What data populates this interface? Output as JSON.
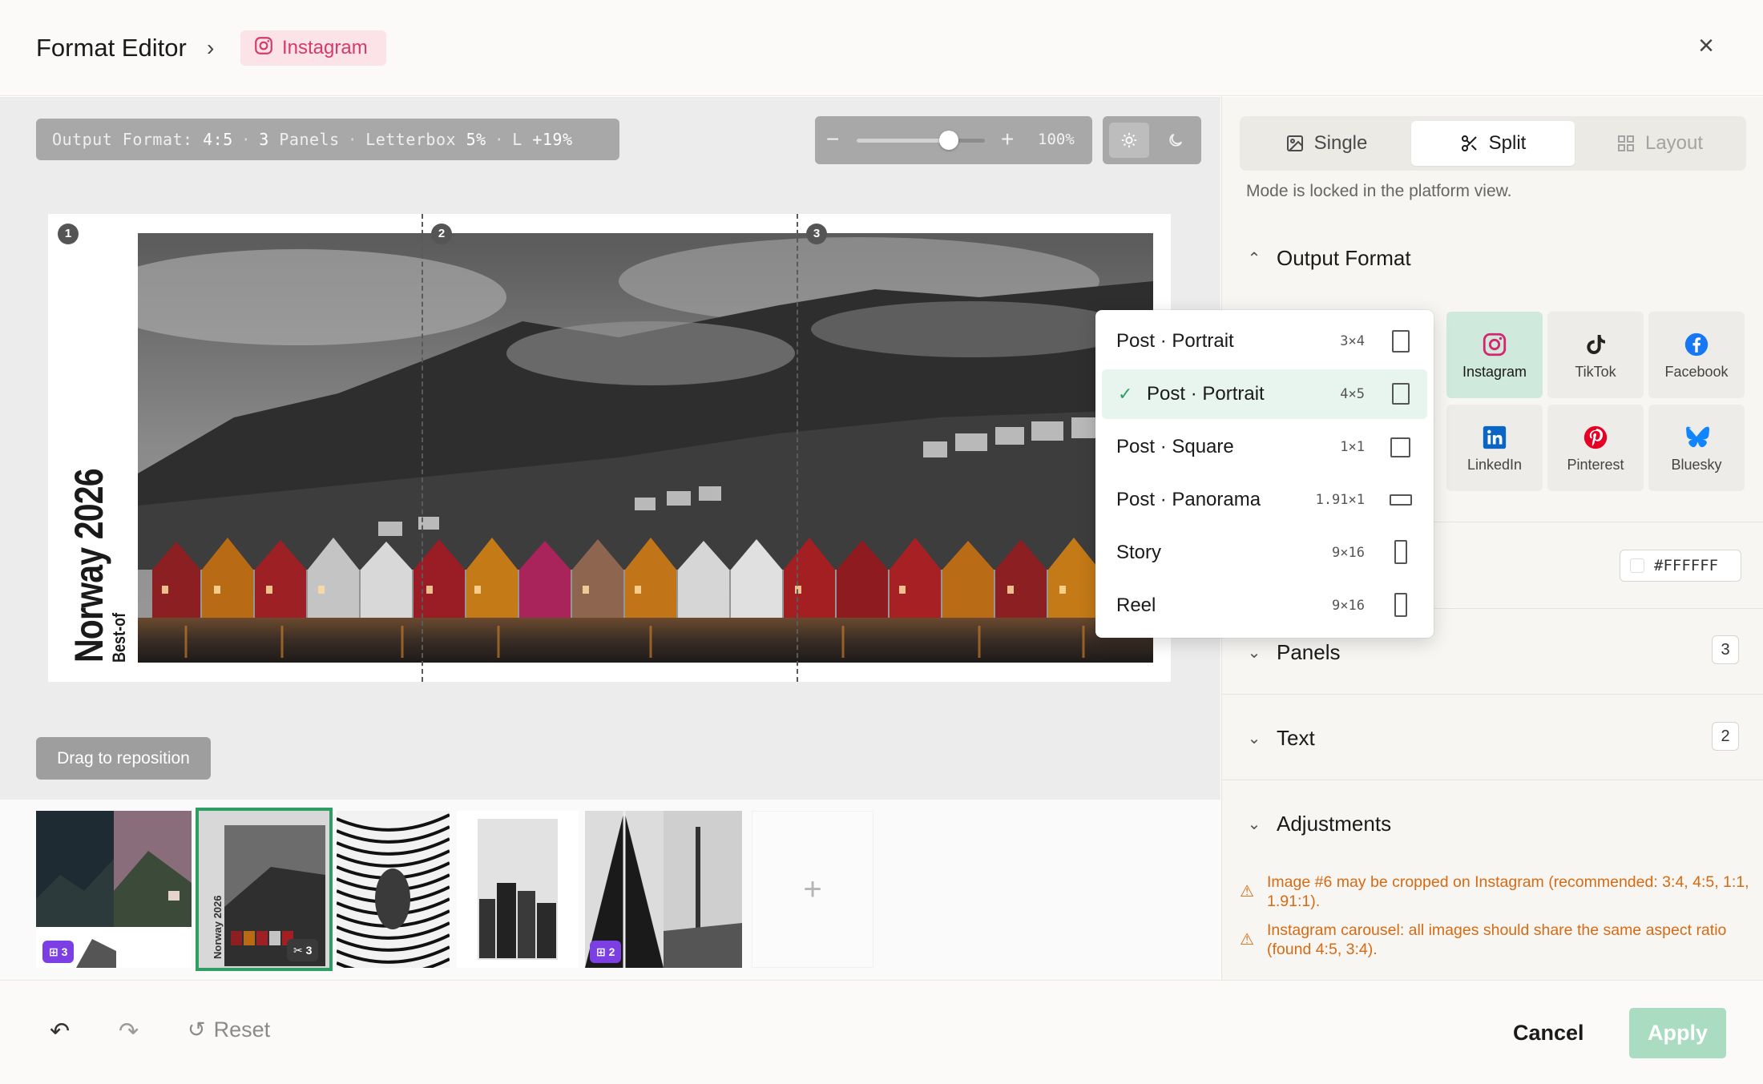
{
  "header": {
    "title": "Format Editor",
    "separator": "›",
    "platform": "Instagram",
    "close": "×"
  },
  "canvas": {
    "format_pill": {
      "label": "Output Format:",
      "ratio": "4:5",
      "panels_count": "3",
      "panels_label": "Panels",
      "letterbox_label": "Letterbox",
      "letterbox_value": "5%",
      "l_label": "L",
      "l_value": "+19%"
    },
    "zoom": {
      "minus": "−",
      "plus": "+",
      "value": "100%",
      "level": 0.72
    },
    "panels": [
      "1",
      "2",
      "3"
    ],
    "side_title": "Norway 2026",
    "side_subtitle": "Best-of",
    "drag_hint": "Drag to reposition"
  },
  "filmstrip": {
    "thumbs": [
      {
        "badge": "⊞ 3",
        "badge_style": "purple"
      },
      {
        "badge": "✂ 3",
        "badge_style": "dark",
        "selected": true
      },
      {
        "badge": ""
      },
      {
        "badge": ""
      },
      {
        "badge": "⊞ 2",
        "badge_style": "purple"
      }
    ],
    "add": "+"
  },
  "footer": {
    "undo": "↶",
    "redo": "↷",
    "reset": "Reset",
    "cancel": "Cancel",
    "apply": "Apply"
  },
  "panel": {
    "modes": [
      {
        "label": "Single",
        "state": "normal"
      },
      {
        "label": "Split",
        "state": "active"
      },
      {
        "label": "Layout",
        "state": "disabled"
      }
    ],
    "mode_note": "Mode is locked in the platform view.",
    "output_format": "Output Format",
    "platforms": [
      {
        "label": "Instagram",
        "active": true
      },
      {
        "label": "TikTok"
      },
      {
        "label": "Facebook"
      },
      {
        "label": "LinkedIn"
      },
      {
        "label": "Pinterest"
      },
      {
        "label": "Bluesky"
      }
    ],
    "background_color": "#FFFFFF",
    "panels_label": "Panels",
    "panels_count": "3",
    "text_label": "Text",
    "text_count": "2",
    "adjustments_label": "Adjustments",
    "warnings": [
      "Image #6 may be cropped on Instagram (recommended: 3:4, 4:5, 1:1, 1.91:1).",
      "Instagram carousel: all images should share the same aspect ratio (found 4:5, 3:4)."
    ]
  },
  "dropdown": {
    "items": [
      {
        "label": "Post · Portrait",
        "ratio": "3×4"
      },
      {
        "label": "Post · Portrait",
        "ratio": "4×5",
        "selected": true
      },
      {
        "label": "Post · Square",
        "ratio": "1×1"
      },
      {
        "label": "Post · Panorama",
        "ratio": "1.91×1"
      },
      {
        "label": "Story",
        "ratio": "9×16"
      },
      {
        "label": "Reel",
        "ratio": "9×16"
      }
    ]
  },
  "colors": {
    "accent_green": "#2f9e64",
    "apply_disabled": "#a9dcc0",
    "instagram_pink": "#d43a6a",
    "warning_orange": "#d76a12",
    "badge_purple": "#7b3fe4"
  }
}
